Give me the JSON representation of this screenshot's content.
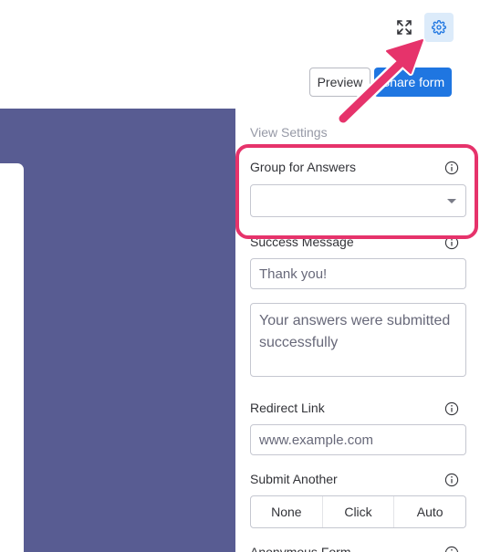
{
  "toolbar": {
    "expand_icon": "expand-icon",
    "settings_icon": "gear-icon",
    "preview_label": "Preview",
    "share_label": "Share form"
  },
  "settings": {
    "section_title": "View Settings",
    "group_for_answers": {
      "label": "Group for Answers",
      "value": ""
    },
    "success_message": {
      "label": "Success Message",
      "title_value": "Thank you!",
      "body_value": "Your answers were submitted successfully"
    },
    "redirect_link": {
      "label": "Redirect Link",
      "placeholder": "www.example.com"
    },
    "submit_another": {
      "label": "Submit Another",
      "options": [
        "None",
        "Click",
        "Auto"
      ]
    },
    "anonymous_form": {
      "label": "Anonymous Form"
    }
  },
  "colors": {
    "canvas": "#585c92",
    "primary": "#1f76e1",
    "annotation": "#e6336b",
    "gear_bg": "#dcebfa"
  }
}
